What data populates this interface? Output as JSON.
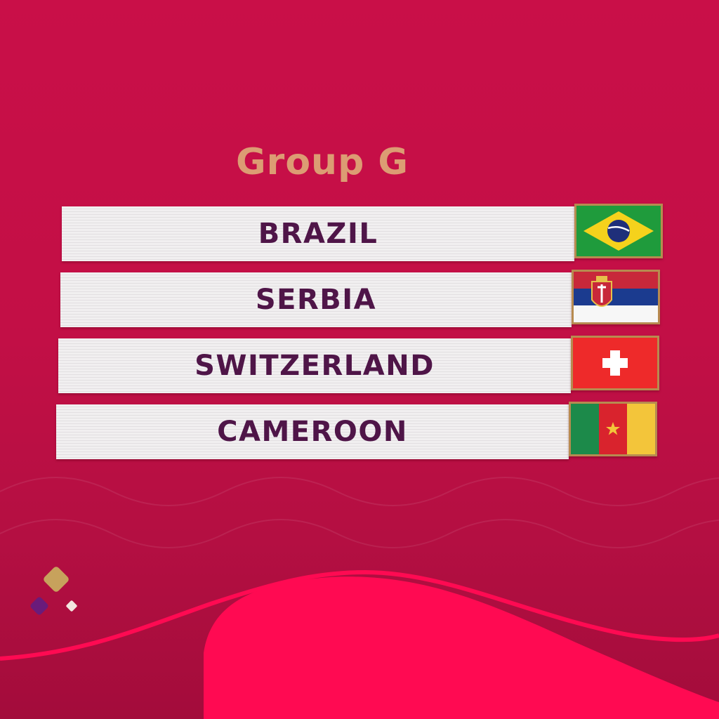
{
  "title": "Group G",
  "teams": [
    {
      "name": "BRAZIL",
      "flag": "brazil-flag"
    },
    {
      "name": "SERBIA",
      "flag": "serbia-flag"
    },
    {
      "name": "SWITZERLAND",
      "flag": "switzerland-flag"
    },
    {
      "name": "CAMEROON",
      "flag": "cameroon-flag"
    }
  ],
  "colors": {
    "background": "#c90f48",
    "wave": "#ff0a52",
    "title": "#dc9c73",
    "team_text": "#4f1548",
    "frame": "#b78b50"
  },
  "logo": "qatar-2022-emblem"
}
